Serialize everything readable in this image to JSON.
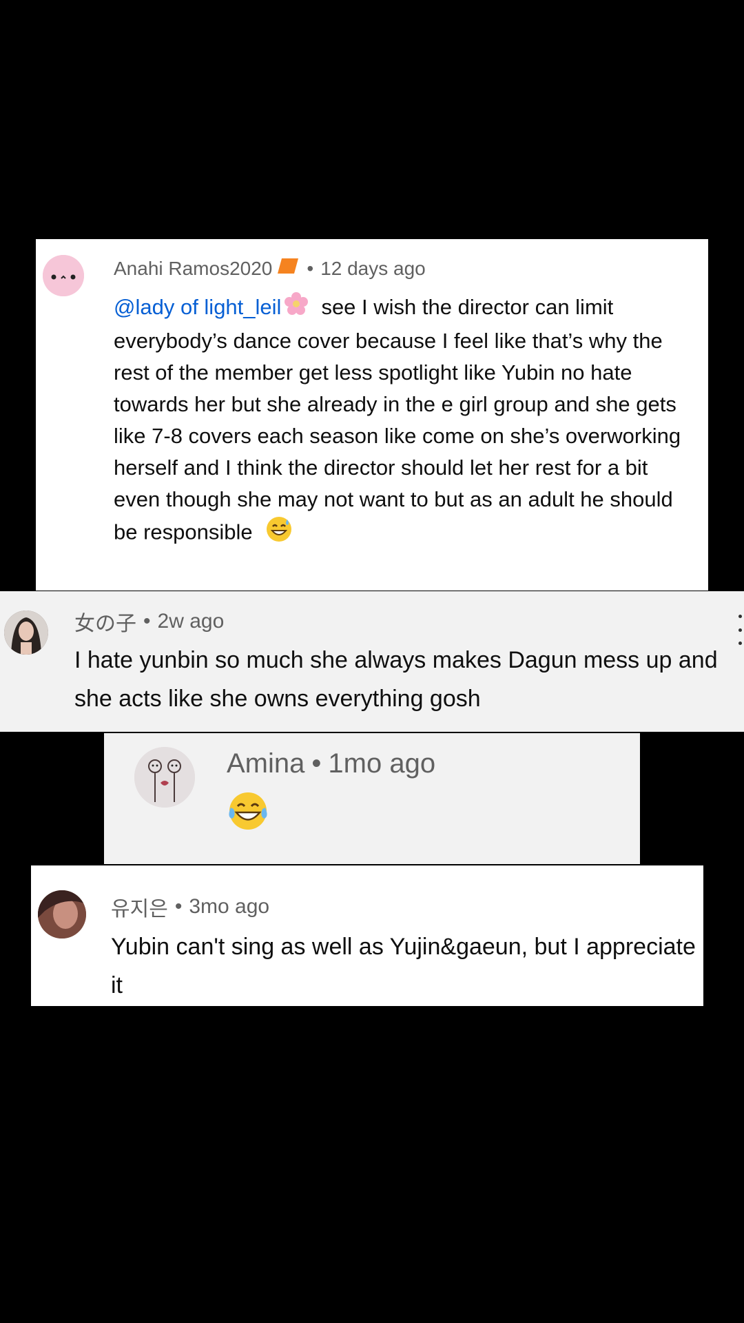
{
  "comments": [
    {
      "author": "Anahi Ramos2020",
      "separator": "•",
      "time": "12 days ago",
      "mention": "@lady of light_leil",
      "text": "see I wish the director can limit everybody’s dance cover because I feel like that’s why the rest of the member get less spotlight like Yubin no hate towards her but she already in the e girl group and she gets like 7-8 covers each season like come on she’s overworking herself and I think the director should let her rest for a bit even though she may not want to but as an adult he should be responsible",
      "badge_icon": "orange-badge-icon",
      "flower_icon": "cherry-blossom-emoji-icon",
      "end_emoji": "grinning-sweat-emoji-icon",
      "accent": "#f58320"
    },
    {
      "author": "女の子",
      "separator": "•",
      "time": "2w ago",
      "text": "I hate yunbin so much she always makes Dagun mess up and she acts like she owns everything gosh",
      "menu_icon": "more-vertical-icon"
    },
    {
      "author": "Amina",
      "separator": "•",
      "time": "1mo ago",
      "emoji": "tears-of-joy-emoji-icon"
    },
    {
      "author": "유지은",
      "separator": "•",
      "time": "3mo ago",
      "text": "Yubin can't sing as well as Yujin&gaeun, but I appreciate it"
    }
  ]
}
